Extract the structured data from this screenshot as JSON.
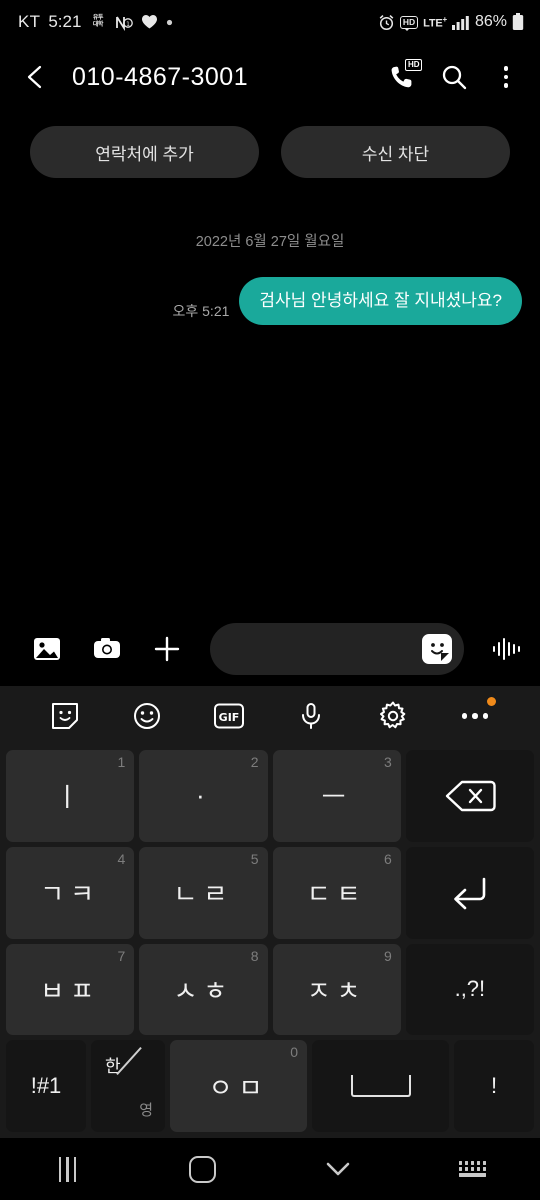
{
  "status_bar": {
    "carrier": "KT",
    "time": "5:21",
    "app_icon_line1": "유투",
    "app_icon_line2": "대학",
    "network": "LTE",
    "network_plus": "+",
    "hd_label": "HD",
    "battery_percent": "86%",
    "icons": [
      "korean-app-icon",
      "vibrate-icon",
      "heart-icon",
      "dot-icon",
      "alarm-icon",
      "hd-icon",
      "lte-icon",
      "signal-icon",
      "battery-icon"
    ]
  },
  "app_bar": {
    "title": "010-4867-3001",
    "back_icon": "chevron-left-icon",
    "call_icon": "hd-call-icon",
    "call_badge": "HD",
    "search_icon": "search-icon",
    "menu_icon": "more-vertical-icon"
  },
  "actions": {
    "add_contact": "연락처에 추가",
    "block": "수신 차단"
  },
  "conversation": {
    "date_separator": "2022년 6월 27일 월요일",
    "messages": [
      {
        "text": "검사님 안녕하세요 잘 지내셨나요?",
        "time": "오후 5:21",
        "side": "outgoing",
        "bubble_color": "#1aa99b"
      }
    ]
  },
  "compose": {
    "gallery_icon": "image-icon",
    "camera_icon": "camera-icon",
    "plus_icon": "plus-icon",
    "input_value": "",
    "input_placeholder": "",
    "sticker_icon": "sticker-icon",
    "voice_icon": "voice-waveform-icon"
  },
  "keyboard_toolbar": {
    "items": [
      {
        "name": "sticker-icon",
        "label": ""
      },
      {
        "name": "emoji-icon",
        "label": ""
      },
      {
        "name": "gif-icon",
        "label": "GIF"
      },
      {
        "name": "microphone-icon",
        "label": ""
      },
      {
        "name": "settings-icon",
        "label": ""
      },
      {
        "name": "more-options-icon",
        "label": ""
      }
    ],
    "badge_color": "#f08a1a"
  },
  "keyboard": {
    "type": "cheonjiin",
    "rows": [
      [
        {
          "label": "ㅣ",
          "num": "1",
          "kind": "char"
        },
        {
          "label": "·",
          "num": "2",
          "kind": "char"
        },
        {
          "label": "ㅡ",
          "num": "3",
          "kind": "char"
        },
        {
          "label": "",
          "num": "",
          "kind": "backspace"
        }
      ],
      [
        {
          "label": "ㄱㅋ",
          "num": "4",
          "kind": "char"
        },
        {
          "label": "ㄴㄹ",
          "num": "5",
          "kind": "char"
        },
        {
          "label": "ㄷㅌ",
          "num": "6",
          "kind": "char"
        },
        {
          "label": "",
          "num": "",
          "kind": "enter"
        }
      ],
      [
        {
          "label": "ㅂㅍ",
          "num": "7",
          "kind": "char"
        },
        {
          "label": "ㅅㅎ",
          "num": "8",
          "kind": "char"
        },
        {
          "label": "ㅈㅊ",
          "num": "9",
          "kind": "char"
        },
        {
          "label": ".,?!",
          "num": "",
          "kind": "punct"
        }
      ],
      [
        {
          "label": "!#1",
          "num": "",
          "kind": "symbols"
        },
        {
          "label": "한/영",
          "num": "",
          "kind": "language"
        },
        {
          "label": "ㅇㅁ",
          "num": "0",
          "kind": "char"
        },
        {
          "label": "",
          "num": "",
          "kind": "space"
        },
        {
          "label": "!",
          "num": "",
          "kind": "punct"
        }
      ]
    ],
    "language_ko": "한",
    "language_en": "영"
  },
  "nav_bar": {
    "recents": "recents-icon",
    "home": "home-icon",
    "back": "hide-keyboard-icon",
    "keyboard_switch": "keyboard-switch-icon"
  }
}
